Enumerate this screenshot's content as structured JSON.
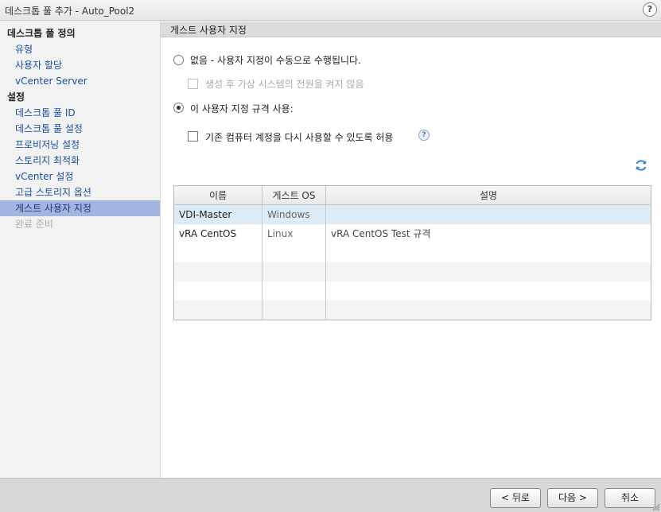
{
  "window": {
    "title": "데스크톱 풀 추가 - Auto_Pool2",
    "help": "?"
  },
  "sidebar": {
    "items": [
      {
        "label": "데스크톱 풀 정의",
        "kind": "head"
      },
      {
        "label": "유형",
        "kind": "link"
      },
      {
        "label": "사용자 할당",
        "kind": "link"
      },
      {
        "label": "vCenter Server",
        "kind": "link"
      },
      {
        "label": "설정",
        "kind": "head"
      },
      {
        "label": "데스크톱 풀 ID",
        "kind": "link"
      },
      {
        "label": "데스크톱 풀 설정",
        "kind": "link"
      },
      {
        "label": "프로비저닝 설정",
        "kind": "link"
      },
      {
        "label": "스토리지 최적화",
        "kind": "link"
      },
      {
        "label": "vCenter 설정",
        "kind": "link"
      },
      {
        "label": "고급 스토리지 옵션",
        "kind": "link"
      },
      {
        "label": "게스트 사용자 지정",
        "kind": "active"
      },
      {
        "label": "완료 준비",
        "kind": "disabled"
      }
    ]
  },
  "main": {
    "section_title": "게스트 사용자 지정",
    "option_none": "없음 - 사용자 지정이 수동으로 수행됩니다.",
    "option_none_sub": "생성 후 가상 시스템의 전원을 켜지 않음",
    "option_spec": "이 사용자 지정 규격 사용:",
    "reuse_accounts": "기존 컴퓨터 계정을 다시 사용할 수 있도록 허용",
    "selected_option": "spec",
    "table": {
      "columns": [
        "이름",
        "게스트 OS",
        "설명"
      ],
      "rows": [
        {
          "name": "VDI-Master",
          "os": "Windows",
          "desc": ""
        },
        {
          "name": "vRA CentOS",
          "os": "Linux",
          "desc": "vRA CentOS Test 규격"
        }
      ]
    }
  },
  "footer": {
    "back": "< 뒤로",
    "next": "다음 >",
    "cancel": "취소"
  },
  "colors": {
    "active_nav": "#a4b4e0",
    "link": "#1a4fa0",
    "selected_row": "#dbecf8"
  }
}
